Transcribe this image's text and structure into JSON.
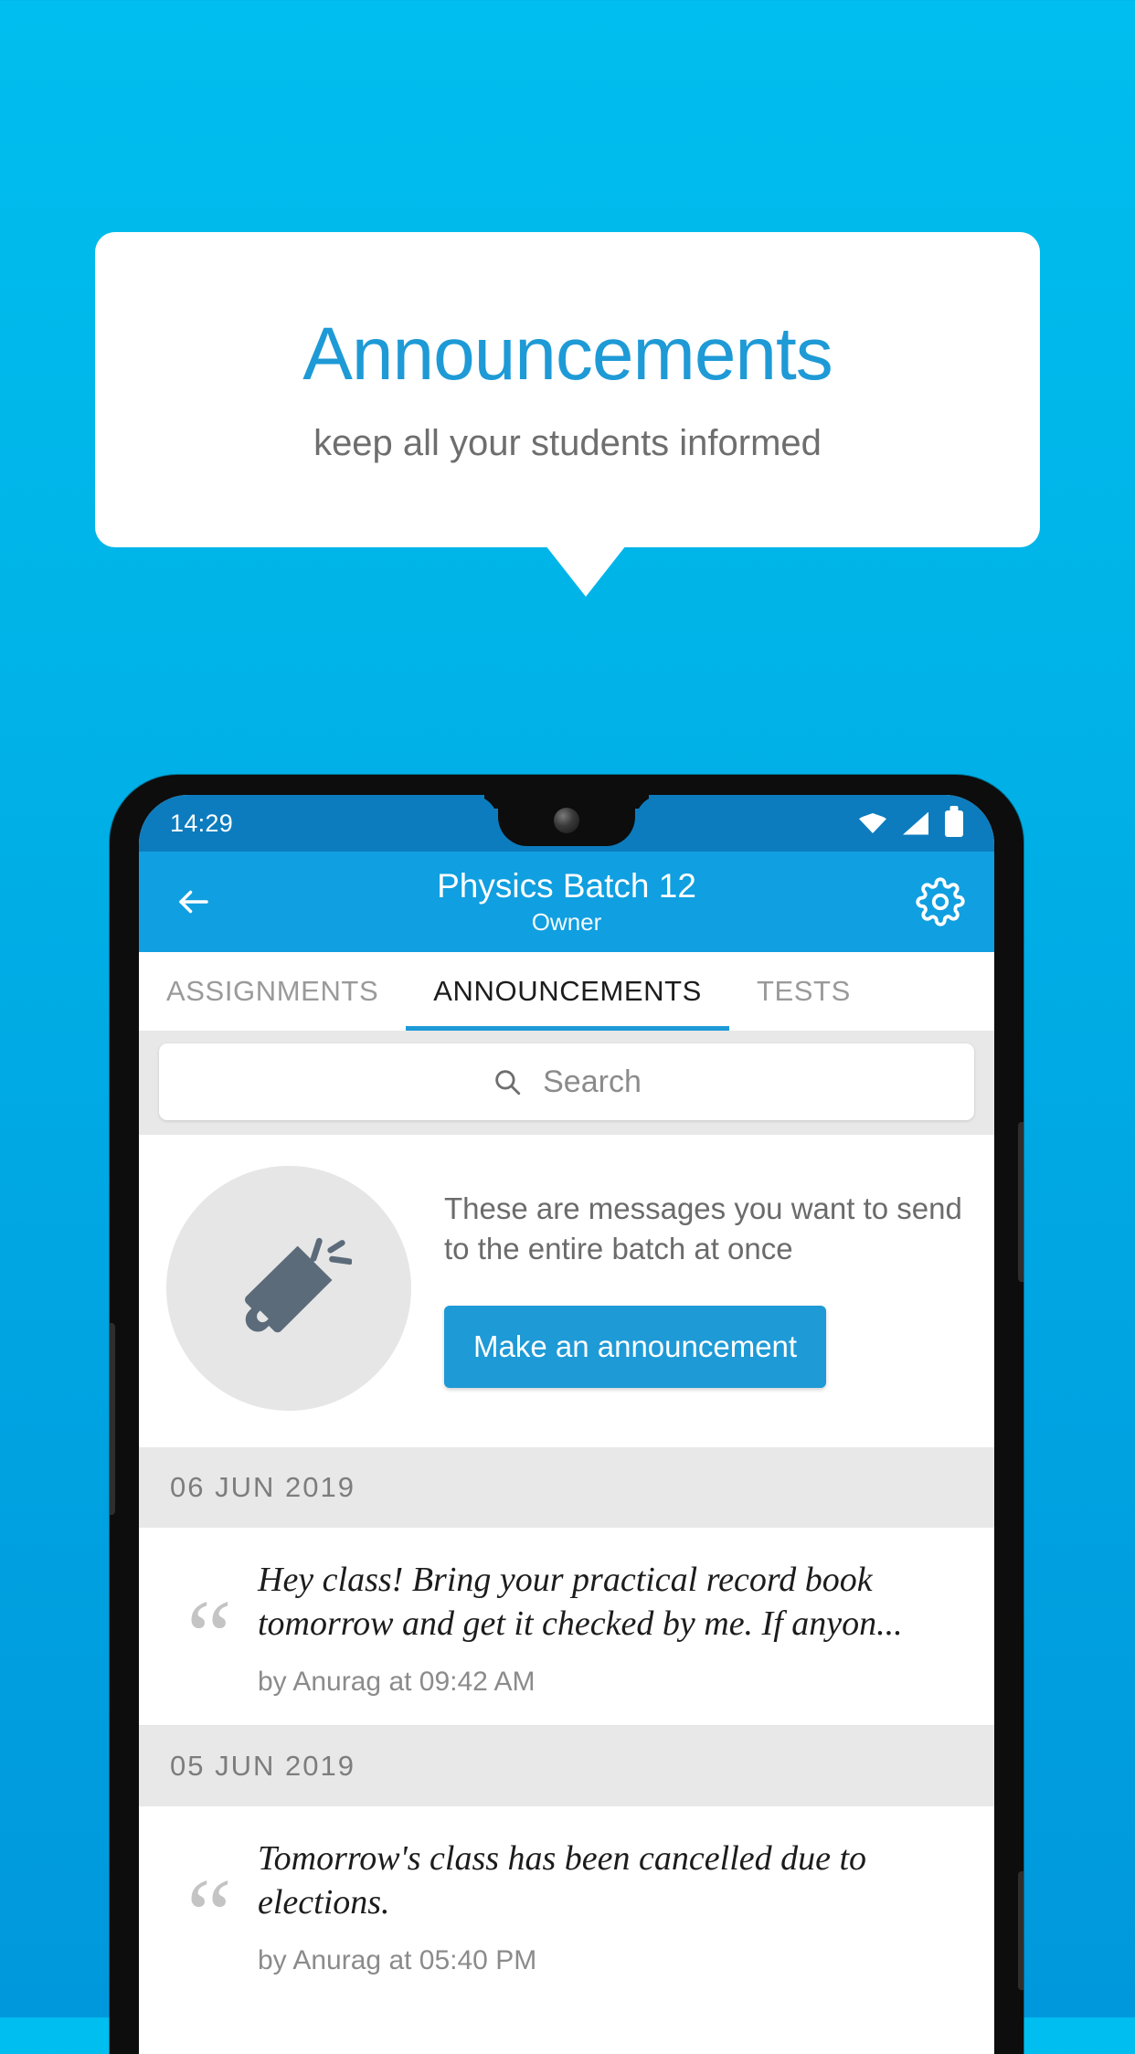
{
  "promo": {
    "title": "Announcements",
    "subtitle": "keep all your students informed",
    "title_color": "#1E9AD6",
    "background_top": "#00BEEF",
    "background_bottom": "#0098DC"
  },
  "phone": {
    "statusbar": {
      "time": "14:29",
      "icons": [
        "wifi-icon",
        "signal-icon",
        "battery-icon"
      ],
      "background": "#0C7CBE"
    },
    "appbar": {
      "back_icon": "back-arrow-icon",
      "title": "Physics Batch 12",
      "subtitle": "Owner",
      "settings_icon": "gear-icon",
      "background": "#109FE0"
    },
    "tabs": {
      "items": [
        {
          "label": "ASSIGNMENTS",
          "active": false
        },
        {
          "label": "ANNOUNCEMENTS",
          "active": true
        },
        {
          "label": "TESTS",
          "active": false
        },
        {
          "label": "",
          "active": false
        }
      ],
      "indicator_color": "#1E9AD6"
    },
    "search": {
      "icon": "search-icon",
      "placeholder": "Search",
      "value": ""
    },
    "empty_state": {
      "icon": "megaphone-icon",
      "description": "These are messages you want to send to the entire batch at once",
      "cta_label": "Make an announcement",
      "cta_color": "#1E9AD6"
    },
    "announcement_groups": [
      {
        "date": "06 JUN 2019",
        "items": [
          {
            "quote_icon": "quote-icon",
            "text": "Hey class! Bring your practical record book tomorrow and get it checked by me. If anyon...",
            "meta": "by Anurag at 09:42 AM"
          }
        ]
      },
      {
        "date": "05 JUN 2019",
        "items": [
          {
            "quote_icon": "quote-icon",
            "text": "Tomorrow's class has been cancelled due to elections.",
            "meta": "by Anurag at 05:40 PM"
          }
        ]
      }
    ]
  }
}
